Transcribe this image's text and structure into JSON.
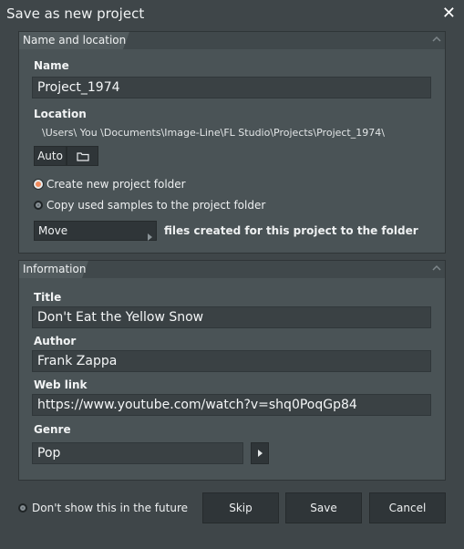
{
  "dialog": {
    "title": "Save as new project"
  },
  "name_location": {
    "header": "Name and location",
    "name_label": "Name",
    "name_value": "Project_1974",
    "location_label": "Location",
    "location_path": "\\Users\\ You \\Documents\\Image-Line\\FL Studio\\Projects\\Project_1974\\",
    "auto_label": "Auto",
    "create_folder_label": "Create new project folder",
    "create_folder_checked": true,
    "copy_samples_label": "Copy used samples to the project folder",
    "copy_samples_checked": false,
    "move_value": "Move",
    "move_suffix": "files created for this project to the folder"
  },
  "information": {
    "header": "Information",
    "title_label": "Title",
    "title_value": "Don't Eat the Yellow Snow",
    "author_label": "Author",
    "author_value": "Frank Zappa",
    "weblink_label": "Web link",
    "weblink_value": "https://www.youtube.com/watch?v=shq0PoqGp84",
    "genre_label": "Genre",
    "genre_value": "Pop"
  },
  "footer": {
    "dont_show_label": "Don't show this in the future",
    "dont_show_checked": false,
    "skip_label": "Skip",
    "save_label": "Save",
    "cancel_label": "Cancel"
  },
  "colors": {
    "background": "#3f4649",
    "panel": "#4a5356",
    "field": "#3a4144",
    "button": "#2f3538",
    "radio_active": "#f08a5c"
  },
  "icons": [
    "close-icon",
    "collapse-icon",
    "folder-icon",
    "radio-icon",
    "chevron-right-icon"
  ]
}
